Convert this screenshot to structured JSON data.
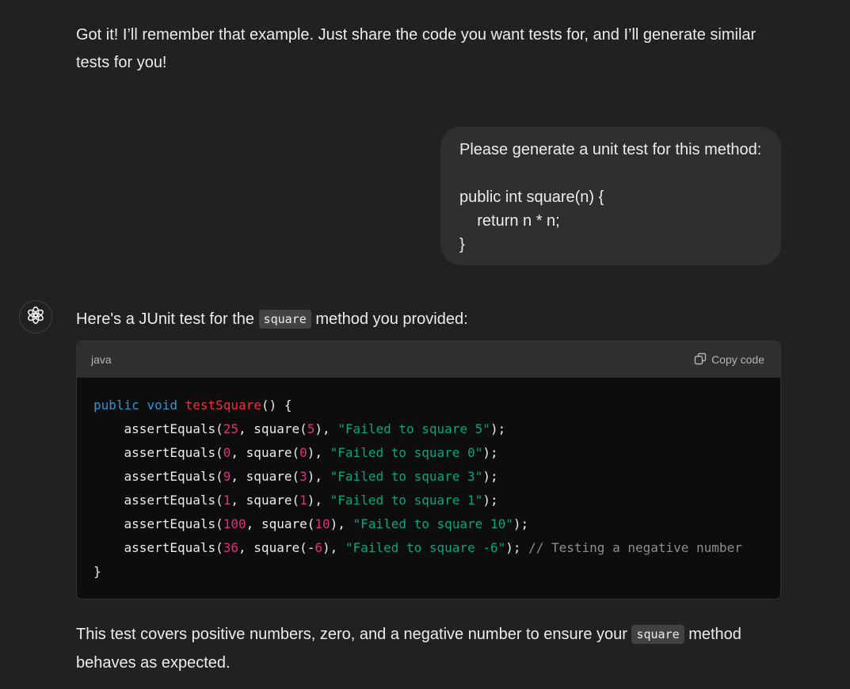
{
  "previous_reply": {
    "text": "Got it! I’ll remember that example. Just share the code you want tests for, and I’ll generate similar tests for you!"
  },
  "user_message": {
    "text": "Please generate a unit test for this method:\n\npublic int square(n) {\n    return n * n;\n}"
  },
  "assistant": {
    "avatar_icon": "openai-logo-icon",
    "intro_before": "Here's a JUnit test for the ",
    "intro_code": "square",
    "intro_after": " method you provided:",
    "code_block": {
      "language": "java",
      "copy_label": "Copy code",
      "copy_icon": "copy-icon",
      "lines": [
        [
          [
            "kw",
            "public"
          ],
          [
            "",
            " "
          ],
          [
            "kw",
            "void"
          ],
          [
            "",
            " "
          ],
          [
            "fn",
            "testSquare"
          ],
          [
            "",
            "() {"
          ]
        ],
        [
          [
            "",
            "    assertEquals("
          ],
          [
            "num",
            "25"
          ],
          [
            "",
            ", square("
          ],
          [
            "num",
            "5"
          ],
          [
            "",
            "), "
          ],
          [
            "str",
            "\"Failed to square 5\""
          ],
          [
            "",
            ");"
          ]
        ],
        [
          [
            "",
            "    assertEquals("
          ],
          [
            "num",
            "0"
          ],
          [
            "",
            ", square("
          ],
          [
            "num",
            "0"
          ],
          [
            "",
            "), "
          ],
          [
            "str",
            "\"Failed to square 0\""
          ],
          [
            "",
            ");"
          ]
        ],
        [
          [
            "",
            "    assertEquals("
          ],
          [
            "num",
            "9"
          ],
          [
            "",
            ", square("
          ],
          [
            "num",
            "3"
          ],
          [
            "",
            "), "
          ],
          [
            "str",
            "\"Failed to square 3\""
          ],
          [
            "",
            ");"
          ]
        ],
        [
          [
            "",
            "    assertEquals("
          ],
          [
            "num",
            "1"
          ],
          [
            "",
            ", square("
          ],
          [
            "num",
            "1"
          ],
          [
            "",
            "), "
          ],
          [
            "str",
            "\"Failed to square 1\""
          ],
          [
            "",
            ");"
          ]
        ],
        [
          [
            "",
            "    assertEquals("
          ],
          [
            "num",
            "100"
          ],
          [
            "",
            ", square("
          ],
          [
            "num",
            "10"
          ],
          [
            "",
            "), "
          ],
          [
            "str",
            "\"Failed to square 10\""
          ],
          [
            "",
            ");"
          ]
        ],
        [
          [
            "",
            "    assertEquals("
          ],
          [
            "num",
            "36"
          ],
          [
            "",
            ", square(-"
          ],
          [
            "num",
            "6"
          ],
          [
            "",
            "), "
          ],
          [
            "str",
            "\"Failed to square -6\""
          ],
          [
            "",
            "); "
          ],
          [
            "cmt",
            "// Testing a negative number"
          ]
        ],
        [
          [
            "",
            "}"
          ]
        ]
      ]
    },
    "outro_before": "This test covers positive numbers, zero, and a negative number to ensure your ",
    "outro_code": "square",
    "outro_after": " method behaves as expected."
  },
  "colors": {
    "background": "#212121",
    "user_bubble": "#2f2f2f",
    "code_header": "#2f2f2f",
    "code_background": "#0d0d0d",
    "keyword": "#2e95d3",
    "function": "#f22c3d",
    "number": "#df3079",
    "string": "#00a67d",
    "comment": "#8e8e8e"
  }
}
